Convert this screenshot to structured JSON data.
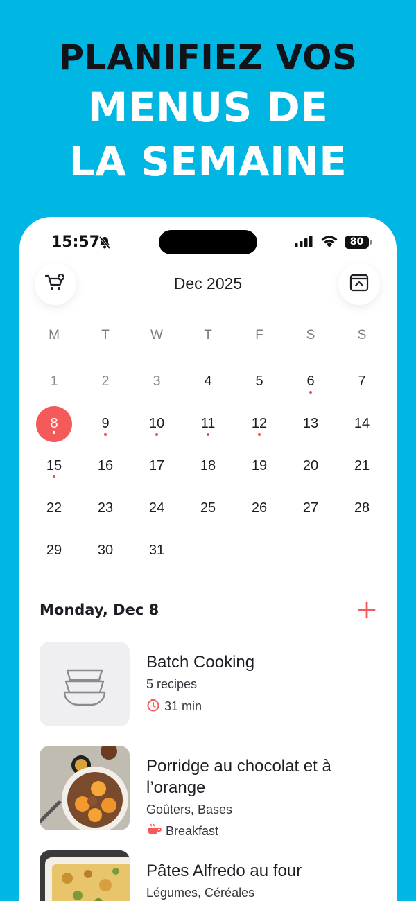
{
  "headline": {
    "line1": "PLANIFIEZ VOS",
    "line2": "MENUS DE",
    "line3": "LA SEMAINE"
  },
  "status_bar": {
    "time": "15:57",
    "battery": "80",
    "icons": [
      "bell-slash-icon",
      "cellular-signal-icon",
      "wifi-icon",
      "battery-icon"
    ]
  },
  "calendar": {
    "month_label": "Dec 2025",
    "weekdays": [
      "M",
      "T",
      "W",
      "T",
      "F",
      "S",
      "S"
    ],
    "days": [
      {
        "n": "1",
        "muted": true,
        "dot": false
      },
      {
        "n": "2",
        "muted": true,
        "dot": false
      },
      {
        "n": "3",
        "muted": true,
        "dot": false
      },
      {
        "n": "4",
        "muted": false,
        "dot": false
      },
      {
        "n": "5",
        "muted": false,
        "dot": false
      },
      {
        "n": "6",
        "muted": false,
        "dot": true
      },
      {
        "n": "7",
        "muted": false,
        "dot": false
      },
      {
        "n": "8",
        "muted": false,
        "dot": true,
        "selected": true
      },
      {
        "n": "9",
        "muted": false,
        "dot": true
      },
      {
        "n": "10",
        "muted": false,
        "dot": true
      },
      {
        "n": "11",
        "muted": false,
        "dot": true
      },
      {
        "n": "12",
        "muted": false,
        "dot": true
      },
      {
        "n": "13",
        "muted": false,
        "dot": false
      },
      {
        "n": "14",
        "muted": false,
        "dot": false
      },
      {
        "n": "15",
        "muted": false,
        "dot": true
      },
      {
        "n": "16",
        "muted": false,
        "dot": false
      },
      {
        "n": "17",
        "muted": false,
        "dot": false
      },
      {
        "n": "18",
        "muted": false,
        "dot": false
      },
      {
        "n": "19",
        "muted": false,
        "dot": false
      },
      {
        "n": "20",
        "muted": false,
        "dot": false
      },
      {
        "n": "21",
        "muted": false,
        "dot": false
      },
      {
        "n": "22",
        "muted": false,
        "dot": false
      },
      {
        "n": "23",
        "muted": false,
        "dot": false
      },
      {
        "n": "24",
        "muted": false,
        "dot": false
      },
      {
        "n": "25",
        "muted": false,
        "dot": false
      },
      {
        "n": "26",
        "muted": false,
        "dot": false
      },
      {
        "n": "27",
        "muted": false,
        "dot": false
      },
      {
        "n": "28",
        "muted": false,
        "dot": false
      },
      {
        "n": "29",
        "muted": false,
        "dot": false
      },
      {
        "n": "30",
        "muted": false,
        "dot": false
      },
      {
        "n": "31",
        "muted": false,
        "dot": false
      }
    ]
  },
  "day_section": {
    "title": "Monday, Dec 8"
  },
  "meals": [
    {
      "title": "Batch Cooking",
      "subtitle": "5 recipes",
      "meta": "31 min",
      "meta_icon": "timer-icon",
      "image": "bowls-placeholder-icon"
    },
    {
      "title": "Porridge au chocolat et à l’orange",
      "subtitle": "Goûters, Bases",
      "meta": "Breakfast",
      "meta_icon": "breakfast-cup-icon",
      "image": "porridge-photo"
    },
    {
      "title": "Pâtes Alfredo au four",
      "subtitle": "Légumes, Céréales",
      "meta": "",
      "meta_icon": "",
      "image": "pasta-bake-photo"
    }
  ],
  "colors": {
    "background": "#00b6e3",
    "accent": "#f45a5a",
    "text_dark": "#1d1d24"
  }
}
